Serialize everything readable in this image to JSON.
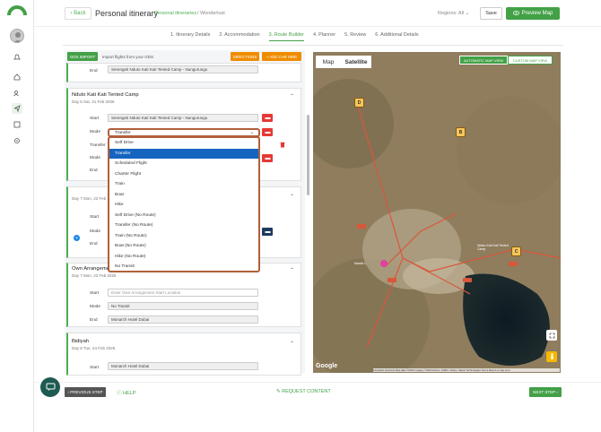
{
  "header": {
    "back_label": "Back",
    "title": "Personal itinerary",
    "crumb_1": "Personal itineraries",
    "crumb_sep": "/",
    "crumb_2": "Wonderlust",
    "regions_label": "Regions: All",
    "save_label": "Save",
    "preview_label": "Preview Map"
  },
  "steps": [
    {
      "label": "1. Itinerary Details",
      "active": false
    },
    {
      "label": "2. Accommodation",
      "active": false
    },
    {
      "label": "3. Route Builder",
      "active": true
    },
    {
      "label": "4. Planner",
      "active": false
    },
    {
      "label": "5. Review",
      "active": false
    },
    {
      "label": "6. Additional Details",
      "active": false
    }
  ],
  "toolbar": {
    "gds_label": "GDS IMPORT",
    "gds_text": "Import flights from your GDS",
    "directions_label": "DIRECTIONS",
    "car_hire_label": "+ ADD CAR HIRE"
  },
  "leg0": {
    "end_label": "End",
    "end_value": "Serengeti Nduto Kati Kati Tented Camp - Nungurungu"
  },
  "leg1": {
    "title": "Nduto Kati Kati Tented Camp",
    "subtitle": "Day 5 Sat, 21 Feb 2026",
    "start_label": "Start",
    "start_value": "Serengeti Nduto Kati Kati Tented Camp - Nungurungu",
    "mode_label": "Mode",
    "mode_value": "Transfer",
    "transfer_label": "Transfer",
    "mode2_label": "Mode",
    "end_label": "End"
  },
  "leg2": {
    "subtitle": "Day 7 Mon, 23 Feb 2026",
    "start_label": "Start",
    "mode_label": "Mode",
    "end_label": "End"
  },
  "dropdown": {
    "options": [
      "Self Drive",
      "Transfer",
      "Scheduled Flight",
      "Charter Flight",
      "Train",
      "Boat",
      "Hike",
      "Self Drive (No Route)",
      "Transfer (No Route)",
      "Train (No Route)",
      "Boat (No Route)",
      "Hike (No Route)",
      "No Transit"
    ],
    "selected_index": 1
  },
  "leg3": {
    "title": "Own Arrangement",
    "subtitle": "Day 7 Mon, 23 Feb 2026",
    "start_label": "Start",
    "start_placeholder": "Enter Own Arrangement Start Location",
    "mode_label": "Mode",
    "mode_value": "No Transit",
    "end_label": "End",
    "end_value": "Monarch Hotel Dubai"
  },
  "leg4": {
    "title": "Bidiyah",
    "subtitle": "Day 8 Tue, 24 Feb 2026",
    "start_label": "Start",
    "start_value": "Monarch Hotel Dubai"
  },
  "map": {
    "tab_map": "Map",
    "tab_satellite": "Satellite",
    "auto_view": "AUTOMATIC MAP VIEW",
    "custom_view": "CUSTOM MAP VIEW",
    "markers": [
      "D",
      "B",
      "C"
    ],
    "place_label": "Ndutu Kati Kati Tented Camp",
    "place_label2": "Masek L.",
    "google": "Google",
    "attribution": "Keyboard shortcuts  Map data ©2024 Imagery ©2024 Airbus, CNES / Airbus, Maxar Technologies   Terms   Report a map error"
  },
  "footer": {
    "prev_label": "PREVIOUS STEP",
    "help_label": "HELP",
    "request_label": "REQUEST CONTENT",
    "next_label": "NEXT STEP"
  },
  "colors": {
    "accent": "#43a047",
    "orange": "#ef8c00",
    "red": "#e53935",
    "navy": "#1e3a5f"
  }
}
